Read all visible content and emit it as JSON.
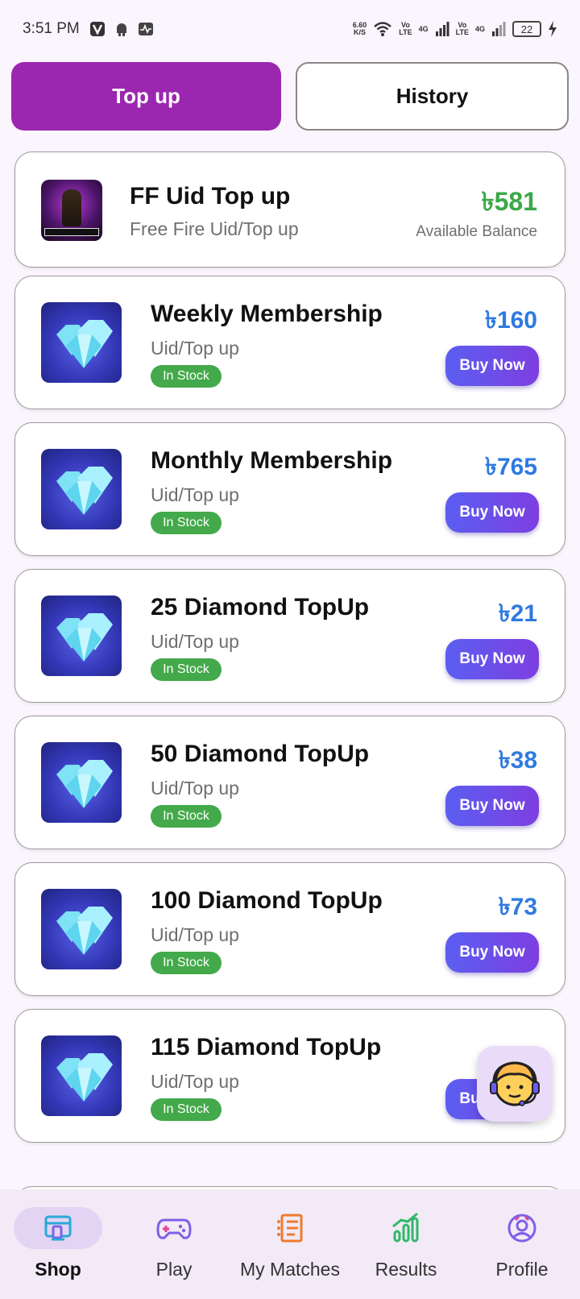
{
  "status_bar": {
    "time": "3:51 PM",
    "net_speed_top": "6.60",
    "net_speed_unit": "K/S",
    "lte1_top": "Vo",
    "lte1_bottom": "LTE",
    "lte2_top": "Vo",
    "lte2_bottom": "LTE",
    "signal_label": "4G",
    "battery": "22"
  },
  "tabs": {
    "topup": "Top up",
    "history": "History"
  },
  "balance": {
    "title": "FF Uid Top up",
    "subtitle": "Free Fire Uid/Top up",
    "amount": "৳581",
    "label": "Available Balance"
  },
  "products": [
    {
      "title": "Weekly Membership",
      "subtitle": "Uid/Top up",
      "stock": "In Stock",
      "price": "৳160",
      "buy": "Buy Now"
    },
    {
      "title": "Monthly Membership",
      "subtitle": "Uid/Top up",
      "stock": "In Stock",
      "price": "৳765",
      "buy": "Buy Now"
    },
    {
      "title": "25 Diamond TopUp",
      "subtitle": "Uid/Top up",
      "stock": "In Stock",
      "price": "৳21",
      "buy": "Buy Now"
    },
    {
      "title": "50 Diamond TopUp",
      "subtitle": "Uid/Top up",
      "stock": "In Stock",
      "price": "৳38",
      "buy": "Buy Now"
    },
    {
      "title": "100 Diamond TopUp",
      "subtitle": "Uid/Top up",
      "stock": "In Stock",
      "price": "৳73",
      "buy": "Buy Now"
    },
    {
      "title": "115 Diamond TopUp",
      "subtitle": "Uid/Top up",
      "stock": "In Stock",
      "price": "",
      "buy": "Buy Now"
    }
  ],
  "nav": {
    "shop": "Shop",
    "play": "Play",
    "matches": "My Matches",
    "results": "Results",
    "profile": "Profile"
  },
  "colors": {
    "tab_active": "#9b27b0",
    "balance_green": "#3aa846",
    "price_blue": "#2f7ae0",
    "stock_green": "#43a94a",
    "buy_gradient_start": "#5b5ef1",
    "buy_gradient_end": "#7d3fe0"
  }
}
